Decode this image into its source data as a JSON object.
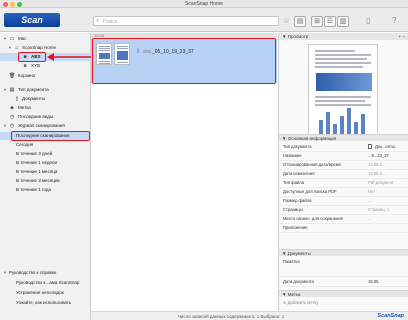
{
  "window": {
    "title": "ScanSnap Home"
  },
  "toolbar": {
    "scan_label": "Scan",
    "search_placeholder": "Поиск",
    "star_icon": "star-icon",
    "grid_view_icon": "grid-icon",
    "list_view_icon": "list-icon",
    "panel_toggle_icon": "panel-icon",
    "help_icon": "question-icon"
  },
  "sidebar": {
    "mac": "Mac",
    "scansnap_home": "ScanSnap Home",
    "folder_abs": "ABS",
    "folder_xyb": "XYB",
    "trash": "Корзина",
    "doc_type": "Тип документа",
    "documents": "Документы",
    "label": "Метка",
    "recent_views": "Последние виды",
    "scan_journal": "Журнал сканирования",
    "recent_scans": "Последние сканирования",
    "today": "Сегодня",
    "last_3_days": "В течение 3 дней",
    "last_week": "В течение 1 недели",
    "last_month": "В течение 1 месяца",
    "last_3_months": "В течение 3 месяцев",
    "last_year": "В течение 1 года",
    "guide": "Руководство к справке",
    "guide_item1": "Руководство к...ама ScanSnap",
    "guide_item2": "Устранение неполадок",
    "guide_item3": "Узнайте, как использовать"
  },
  "content": {
    "date_header": "15.05.",
    "file_name": "_05_10_19_23_37"
  },
  "status": {
    "text": "Число записей данных содержимого: 1 Выбрано: 1",
    "brand": "ScanSnap"
  },
  "panel": {
    "preview_header": "Просмотр",
    "info_header": "Основная информация",
    "rows": [
      {
        "label": "Тип документа",
        "value": "Док...енты"
      },
      {
        "label": "Название",
        "value": "...9...23_37"
      },
      {
        "label": "Отсканированная дата/время",
        "value": "15.05.2..."
      },
      {
        "label": "Дата изменения",
        "value": "15.05.2..."
      },
      {
        "label": "Тип файла",
        "value": "Pdf-документ"
      },
      {
        "label": "Доступные для поиска PDF",
        "value": "Нет"
      },
      {
        "label": "Размер файла",
        "value": "..."
      },
      {
        "label": "Страницы",
        "value": "Страниц: 1"
      },
      {
        "label": "Место назнач. для сохранения",
        "value": "..."
      },
      {
        "label": "Приложение",
        "value": ""
      }
    ],
    "documents_header": "Документы",
    "note_label": "Памятка",
    "doc_date_label": "Дата документа",
    "doc_date_value": "15.05.",
    "label_header": "Метка",
    "add_label": "Добавить метку"
  }
}
